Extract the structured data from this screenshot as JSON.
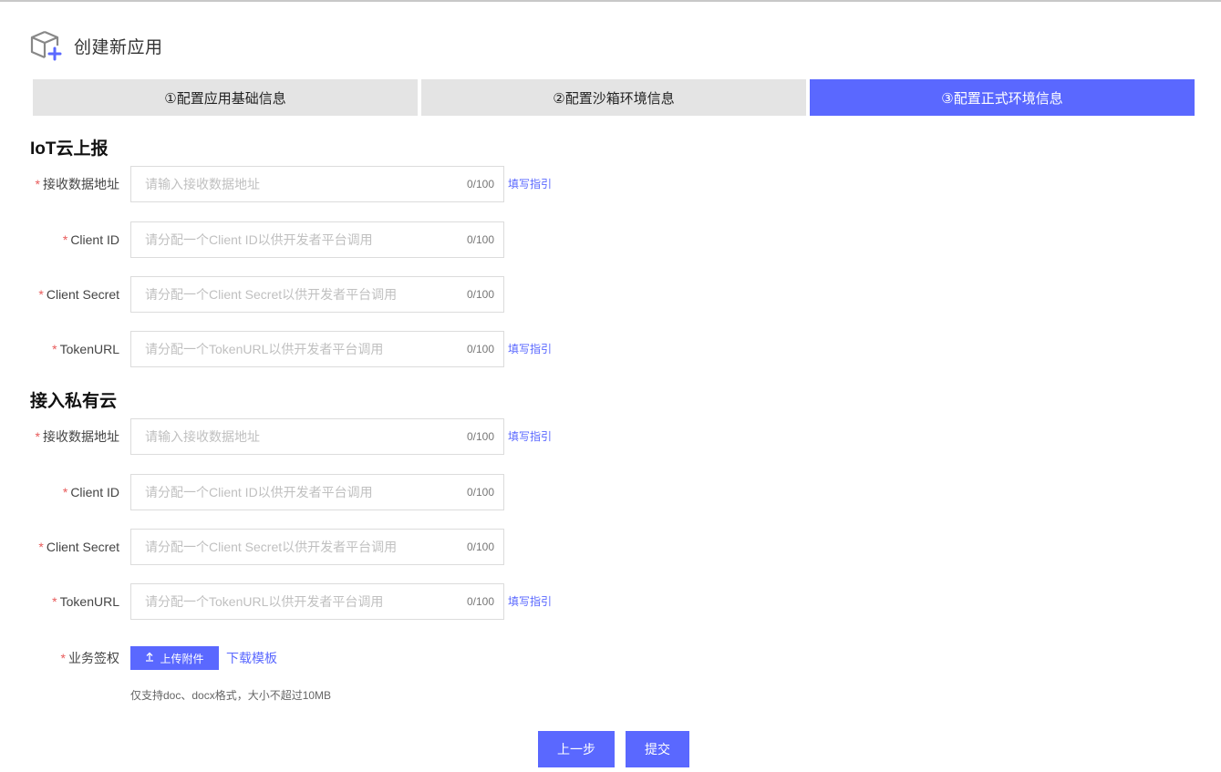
{
  "header": {
    "title": "创建新应用",
    "icon": "box-plus-icon"
  },
  "steps": [
    {
      "label": "①配置应用基础信息",
      "active": false
    },
    {
      "label": "②配置沙箱环境信息",
      "active": false
    },
    {
      "label": "③配置正式环境信息",
      "active": true
    }
  ],
  "iot_section": {
    "title": "IoT云上报",
    "fields": [
      {
        "label": "接收数据地址",
        "placeholder": "请输入接收数据地址",
        "value": "",
        "count": "0/100",
        "guide": "填写指引"
      },
      {
        "label": "Client ID",
        "placeholder": "请分配一个Client ID以供开发者平台调用",
        "value": "",
        "count": "0/100"
      },
      {
        "label": "Client Secret",
        "placeholder": "请分配一个Client Secret以供开发者平台调用",
        "value": "",
        "count": "0/100"
      },
      {
        "label": "TokenURL",
        "placeholder": "请分配一个TokenURL以供开发者平台调用",
        "value": "",
        "count": "0/100",
        "guide": "填写指引"
      }
    ]
  },
  "private_section": {
    "title": "接入私有云",
    "fields": [
      {
        "label": "接收数据地址",
        "placeholder": "请输入接收数据地址",
        "value": "",
        "count": "0/100",
        "guide": "填写指引"
      },
      {
        "label": "Client ID",
        "placeholder": "请分配一个Client ID以供开发者平台调用",
        "value": "",
        "count": "0/100"
      },
      {
        "label": "Client Secret",
        "placeholder": "请分配一个Client Secret以供开发者平台调用",
        "value": "",
        "count": "0/100"
      },
      {
        "label": "TokenURL",
        "placeholder": "请分配一个TokenURL以供开发者平台调用",
        "value": "",
        "count": "0/100",
        "guide": "填写指引"
      }
    ]
  },
  "upload": {
    "label": "业务签权",
    "button_label": "上传附件",
    "button_icon": "upload-icon",
    "download_label": "下载模板",
    "hint": "仅支持doc、docx格式，大小不超过10MB"
  },
  "actions": {
    "prev_label": "上一步",
    "submit_label": "提交"
  },
  "required_mark": "*",
  "colors": {
    "accent": "#5a68ff",
    "required": "#e85a5a",
    "step_inactive": "#e4e4e4"
  }
}
